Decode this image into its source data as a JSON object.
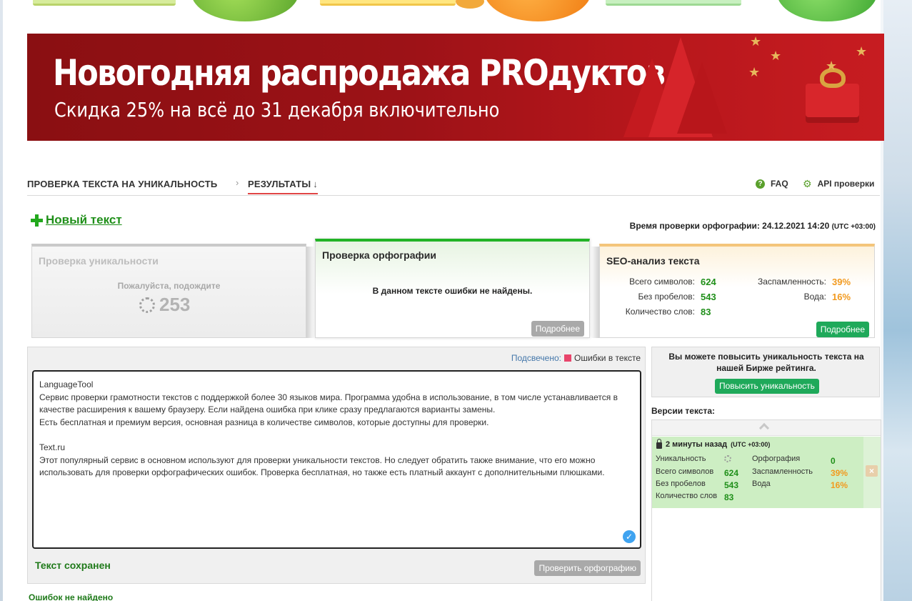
{
  "banner": {
    "title": "Новогодняя распродажа PROдуктов",
    "subtitle": "Скидка 25% на всё до 31 декабря включительно"
  },
  "breadcrumb": {
    "item1": "ПРОВЕРКА ТЕКСТА НА УНИКАЛЬНОСТЬ",
    "separator": "›",
    "item2": "РЕЗУЛЬТАТЫ",
    "item2_arrow": "↓"
  },
  "top_links": {
    "faq": "FAQ",
    "api": "API проверки"
  },
  "new_text": "Новый текст",
  "check_time": {
    "label": "Время проверки орфографии: 24.12.2021 14:20",
    "tz": "(UTC +03:00)"
  },
  "uniqueness_panel": {
    "title": "Проверка уникальности",
    "wait": "Пожалуйста, подождите",
    "count": "253"
  },
  "spelling_panel": {
    "title": "Проверка орфографии",
    "message": "В данном тексте ошибки не найдены.",
    "more": "Подробнее"
  },
  "seo_panel": {
    "title": "SEO-анализ текста",
    "total_chars_label": "Всего символов:",
    "total_chars": "624",
    "no_spaces_label": "Без пробелов:",
    "no_spaces": "543",
    "words_label": "Количество слов:",
    "words": "83",
    "spam_label": "Заспамленность:",
    "spam": "39%",
    "water_label": "Вода:",
    "water": "16%",
    "more": "Подробнее"
  },
  "editor": {
    "legend_label": "Подсвечено:",
    "legend_text": "Ошибки в тексте",
    "paragraphs": [
      "LanguageTool\nСервис проверки грамотности текстов с поддержкой более 30 языков мира. Программа удобна в использование, в том числе устанавливается в качестве расширения к вашему браузеру. Если найдена ошибка при клике сразу предлагаются варианты замены.\nЕсть бесплатная и премиум версия, основная разница в количестве символов, которые доступны для проверки.",
      "Text.ru\nЭтот популярный сервис в основном используют для проверки уникальности текстов. Но следует обратить также внимание, что его можно использовать для проверки орфографических ошибок. Проверка бесплатная, но также есть платный аккаунт с дополнительными плюшками."
    ],
    "saved": "Текст сохранен",
    "check_spelling": "Проверить орфографию",
    "errors_none": "Ошибок не найдено"
  },
  "boost": {
    "text": "Вы можете повысить уникальность текста на нашей Бирже рейтинга.",
    "button": "Повысить уникальность"
  },
  "versions": {
    "title": "Версии текста:",
    "item": {
      "time": "2 минуты назад",
      "tz": "(UTC +03:00)",
      "uniq_label": "Уникальность",
      "spell_label": "Орфография",
      "spell": "0",
      "total_label": "Всего символов",
      "total": "624",
      "spam_label": "Заспамленность",
      "spam": "39%",
      "nospace_label": "Без пробелов",
      "nospace": "543",
      "water_label": "Вода",
      "water": "16%",
      "words_label": "Количество слов",
      "words": "83",
      "delete": "×"
    }
  },
  "colors": {
    "green": "#1f8f19",
    "orange": "#f29a1f",
    "button_green": "#1fa95a",
    "banner_red": "#9d1217"
  }
}
